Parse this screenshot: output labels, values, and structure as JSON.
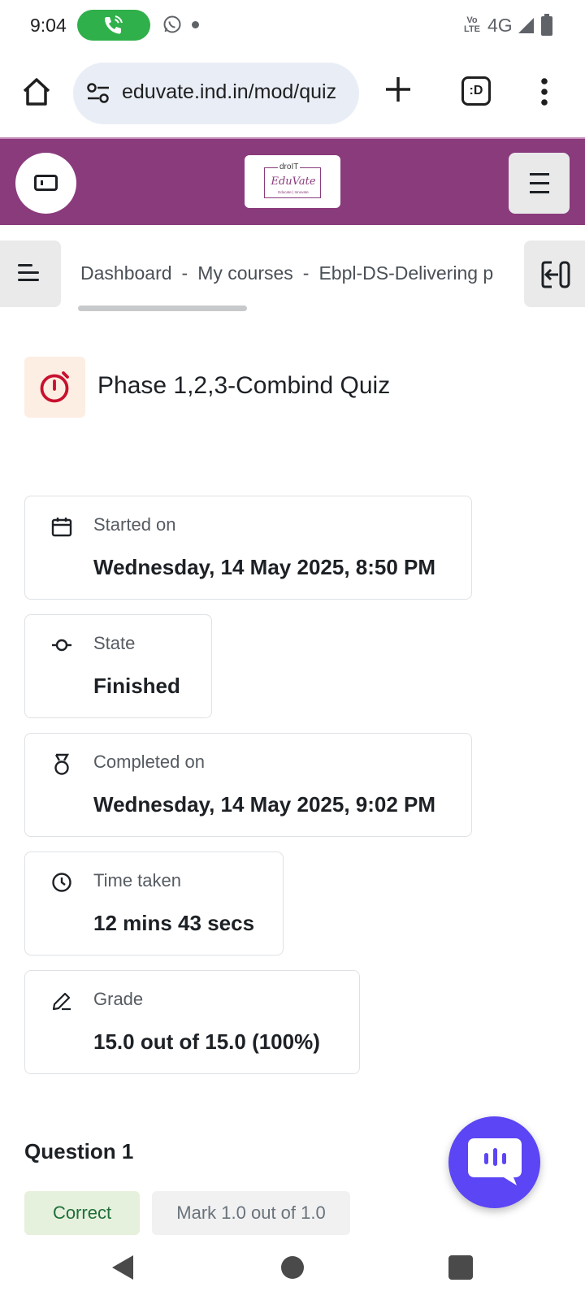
{
  "status_bar": {
    "time": "9:04",
    "network": "4G",
    "volte": "Vo\nLTE"
  },
  "browser": {
    "url": "eduvate.ind.in/mod/quiz",
    "tab_label": ":D"
  },
  "site": {
    "logo_top": "droIT",
    "logo_name": "EduVate",
    "logo_tagline": "Educate | Innovate"
  },
  "breadcrumb": {
    "items": [
      "Dashboard",
      "My courses",
      "Ebpl-DS-Delivering p"
    ],
    "separator": "-"
  },
  "page": {
    "title": "Phase 1,2,3-Combind Quiz"
  },
  "summary": {
    "started_on": {
      "label": "Started on",
      "value": "Wednesday, 14 May 2025, 8:50 PM"
    },
    "state": {
      "label": "State",
      "value": "Finished"
    },
    "completed_on": {
      "label": "Completed on",
      "value": "Wednesday, 14 May 2025, 9:02 PM"
    },
    "time_taken": {
      "label": "Time taken",
      "value": "12 mins 43 secs"
    },
    "grade": {
      "label": "Grade",
      "value": "15.0 out of 15.0 (100%)"
    }
  },
  "question": {
    "title": "Question 1",
    "status": "Correct",
    "mark": "Mark 1.0 out of 1.0"
  },
  "colors": {
    "header_bg": "#8a3b7c",
    "correct_bg": "#e6f1dd",
    "chat_fab": "#5b45f5",
    "quiz_icon": "#c8102e"
  },
  "icons": {
    "home": "home-icon",
    "site_settings": "tune-icon",
    "new_tab": "plus-icon",
    "tabs": "tabs-icon",
    "menu": "more-vert-icon",
    "drawer": "drawer-toggle-icon",
    "nav_menu": "hamburger-icon",
    "course_index": "course-index-icon",
    "block_drawer": "block-drawer-icon",
    "quiz": "stopwatch-icon",
    "calendar": "calendar-icon",
    "state": "commit-icon",
    "completed": "medal-icon",
    "time": "clock-icon",
    "grade": "pencil-icon",
    "chat": "chat-bubble-icon"
  }
}
